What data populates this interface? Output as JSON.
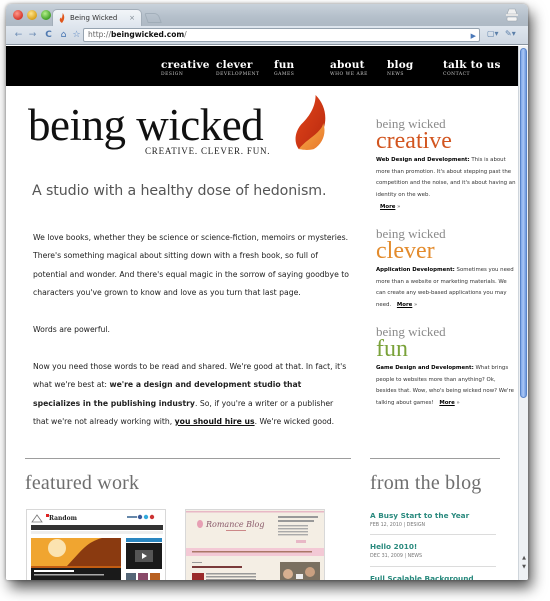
{
  "browser": {
    "tab_title": "Being Wicked",
    "tab_close": "×",
    "url_prefix": "http://",
    "url_host": "beingwicked.com",
    "url_suffix": "/",
    "back_glyph": "←",
    "forward_glyph": "→",
    "reload_glyph": "C",
    "home_glyph": "⌂",
    "star_glyph": "☆",
    "go_glyph": "▶",
    "page_menu_glyph": "▢▾",
    "wrench_glyph": "✎▾"
  },
  "nav": [
    {
      "title": "creative",
      "sub": "design"
    },
    {
      "title": "clever",
      "sub": "development"
    },
    {
      "title": "fun",
      "sub": "games"
    },
    {
      "title": "about",
      "sub": "who we are"
    },
    {
      "title": "blog",
      "sub": "news"
    },
    {
      "title": "talk to us",
      "sub": "contact"
    }
  ],
  "logo": {
    "wordmark": "being wicked",
    "tagline": "CREATIVE.  CLEVER.  FUN."
  },
  "headline": "A studio with a healthy dose of hedonism.",
  "body": {
    "p1": "We love books, whether they be science or science-fiction, memoirs or mysteries. There's something magical about sitting down with a fresh book, so full of potential and wonder. And there's equal magic in the sorrow of saying goodbye to characters you've grown to know and love as you turn that last page.",
    "p2": "Words are powerful.",
    "p3_a": "Now you need those words to be read and shared. We're good at that. In fact, it's what we're best at: ",
    "p3_bold": "we're a design and development studio that specializes in the publishing industry",
    "p3_b": ". So, if you're a writer or a publisher that we're not already working with, ",
    "p3_link": "you should hire us",
    "p3_c": ". We're wicked good."
  },
  "services": [
    {
      "kicker": "being wicked",
      "title": "creative",
      "color": "#d2551f",
      "lead": "Web Design and Development:",
      "text": " This is about more than promotion. It's about stepping past the competition and the noise, and it's about having an identity on the web.",
      "more": "More",
      "arrow": "»"
    },
    {
      "kicker": "being wicked",
      "title": "clever",
      "color": "#e38b2c",
      "lead": "Application Development:",
      "text": " Sometimes you need more than a website or marketing materials. We can create any web-based applications you may need.",
      "more": "More",
      "arrow": "»"
    },
    {
      "kicker": "being wicked",
      "title": "fun",
      "color": "#7aa23a",
      "lead": "Game Design and Development:",
      "text": " What brings people to websites more than anything? Ok, besides that. Wow, who's being wicked now? We're talking about games!",
      "more": "More",
      "arrow": "»"
    }
  ],
  "featured": {
    "heading": "featured work",
    "items": [
      {
        "name": "Random House site thumbnail",
        "label": "Random"
      },
      {
        "name": "Romance Blog site thumbnail",
        "label": "Romance Blog"
      }
    ]
  },
  "blog": {
    "heading": "from the blog",
    "posts": [
      {
        "title": "A Busy Start to the Year",
        "meta": "Feb 12, 2010 | Design"
      },
      {
        "title": "Hello 2010!",
        "meta": "Dec 31, 2009 | News"
      },
      {
        "title": "Full Scalable Background Images",
        "meta": ""
      }
    ]
  },
  "colors": {
    "accent_creative": "#d2551f",
    "accent_clever": "#e38b2c",
    "accent_fun": "#7aa23a",
    "blog_link": "#2a8a7e",
    "nav_bg": "#000000"
  }
}
